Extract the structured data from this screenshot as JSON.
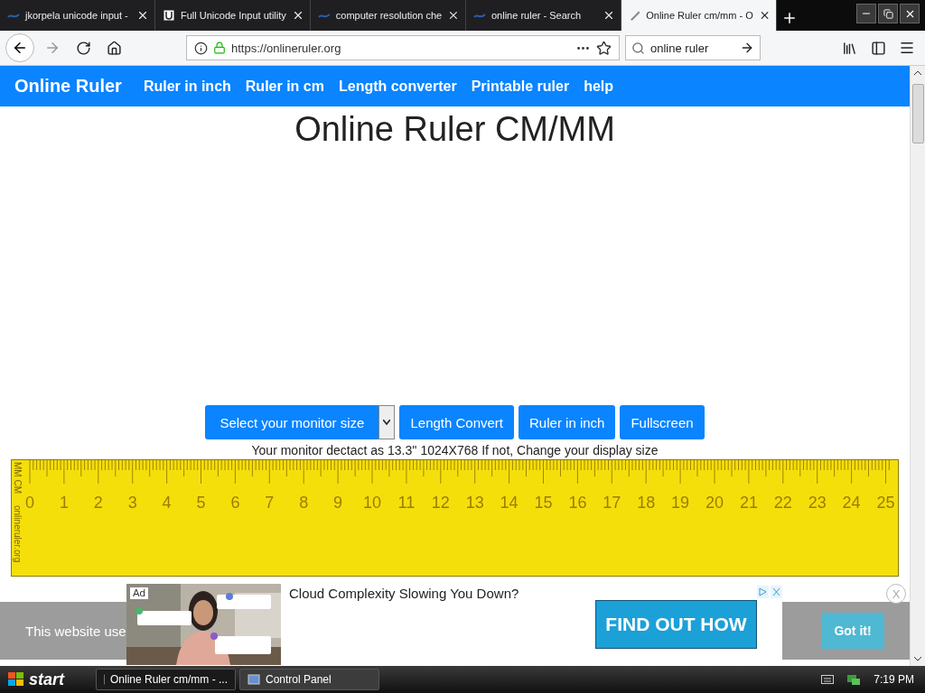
{
  "browser": {
    "tabs": [
      {
        "label": "jkorpela unicode input -",
        "selected": false
      },
      {
        "label": "Full Unicode Input utility",
        "selected": false
      },
      {
        "label": "computer resolution che",
        "selected": false
      },
      {
        "label": "online ruler - Search",
        "selected": false
      },
      {
        "label": "Online Ruler cm/mm - O",
        "selected": true
      }
    ],
    "url": "https://onlineruler.org",
    "search": "online ruler"
  },
  "site_nav": {
    "brand": "Online Ruler",
    "links": [
      "Ruler in inch",
      "Ruler in cm",
      "Length converter",
      "Printable ruler",
      "help"
    ]
  },
  "page": {
    "heading": "Online Ruler CM/MM",
    "select": "Select your monitor size",
    "buttons": [
      "Length Convert",
      "Ruler in inch",
      "Fullscreen"
    ],
    "monitor_note": "Your monitor dectact as 13.3'' 1024X768 If not, Change your display size",
    "ruler": {
      "unit_label": "MM CM",
      "site_label": "onlineruler.org",
      "numbers": [
        "0",
        "1",
        "2",
        "3",
        "4",
        "5",
        "6",
        "7",
        "8",
        "9",
        "10",
        "11",
        "12",
        "13",
        "14",
        "15",
        "16",
        "17",
        "18",
        "19",
        "20",
        "21",
        "22",
        "23",
        "24",
        "25"
      ]
    }
  },
  "ad": {
    "badge": "Ad",
    "headline": "Cloud Complexity Slowing You Down?",
    "cta": "FIND OUT HOW",
    "close": "X"
  },
  "cookie_banner": {
    "text": "This website use",
    "button": "Got it!"
  },
  "taskbar": {
    "start": "start",
    "tasks": [
      {
        "label": "Online Ruler cm/mm - ...",
        "selected": true
      },
      {
        "label": "Control Panel",
        "selected": false
      }
    ],
    "clock": "7:19 PM"
  }
}
